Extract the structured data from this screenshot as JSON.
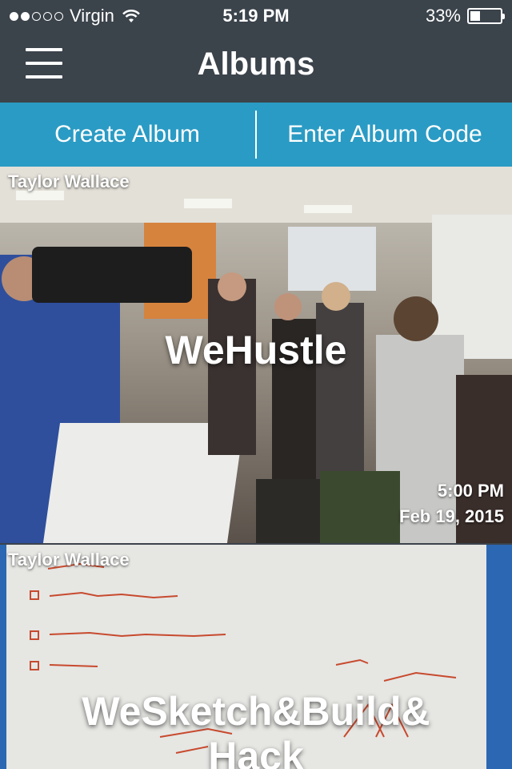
{
  "status_bar": {
    "carrier": "Virgin",
    "time": "5:19 PM",
    "battery_label": "33%",
    "battery_level": 0.33,
    "signal_bars_filled": 2,
    "signal_bars_total": 5
  },
  "nav": {
    "title": "Albums",
    "menu_icon": "hamburger-menu-icon"
  },
  "actions": {
    "create_label": "Create Album",
    "enter_code_label": "Enter Album Code"
  },
  "albums": [
    {
      "owner": "Taylor Wallace",
      "title": "WeHustle",
      "time": "5:00 PM",
      "date": "Feb 19, 2015"
    },
    {
      "owner": "Taylor Wallace",
      "title": "WeSketch&Build&Hack"
    }
  ],
  "colors": {
    "header": "#3b434b",
    "accent": "#2a9bc4",
    "text": "#ffffff"
  }
}
